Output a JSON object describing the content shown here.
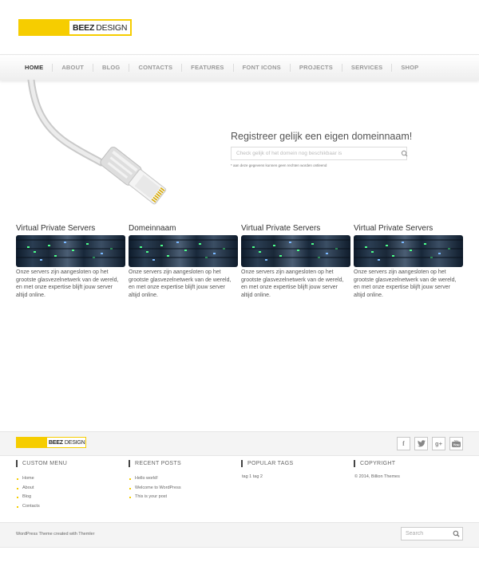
{
  "logo": {
    "bold": "BEEZ",
    "rest": "DESIGN"
  },
  "nav": [
    "HOME",
    "ABOUT",
    "BLOG",
    "CONTACTS",
    "FEATURES",
    "FONT ICONS",
    "PROJECTS",
    "SERVICES",
    "SHOP"
  ],
  "domain": {
    "title": "Registreer gelijk een eigen domeinnaam!",
    "placeholder": "Check gelijk of het domein nog beschikbaar is",
    "disclaimer": "* aan deze gegevens kunnen geen rechten worden ontleend"
  },
  "features": [
    {
      "title": "Virtual Private Servers",
      "text": "Onze servers zijn aangesloten op het grootste glasvezelnetwerk van de wereld, en met onze expertise blijft jouw server altijd online."
    },
    {
      "title": "Domeinnaam",
      "text": "Onze servers zijn aangesloten op het grootste glasvezelnetwerk van de wereld, en met onze expertise blijft jouw server altijd online."
    },
    {
      "title": "Virtual Private Servers",
      "text": "Onze servers zijn aangesloten op het grootste glasvezelnetwerk van de wereld, en met onze expertise blijft jouw server altijd online."
    },
    {
      "title": "Virtual Private Servers",
      "text": "Onze servers zijn aangesloten op het grootste glasvezelnetwerk van de wereld, en met onze expertise blijft jouw server altijd online."
    }
  ],
  "social": [
    "facebook-icon",
    "twitter-icon",
    "google-plus-icon",
    "youtube-icon"
  ],
  "footer": {
    "custom_menu": {
      "title": "CUSTOM MENU",
      "items": [
        "Home",
        "About",
        "Blog",
        "Contacts"
      ]
    },
    "recent_posts": {
      "title": "RECENT POSTS",
      "items": [
        "Hello world!",
        "Welcome to WordPress",
        "This is your post"
      ]
    },
    "popular_tags": {
      "title": "POPULAR TAGS",
      "tags": "tag 1 tag 2"
    },
    "copyright": {
      "title": "COPYRIGHT",
      "text": "© 2014, Billion Themes"
    },
    "credit": "WordPress Theme created with Themler",
    "search_placeholder": "Search"
  },
  "colors": {
    "accent": "#f6cd00",
    "text": "#444444",
    "bar_bg": "#f4f4f4"
  }
}
